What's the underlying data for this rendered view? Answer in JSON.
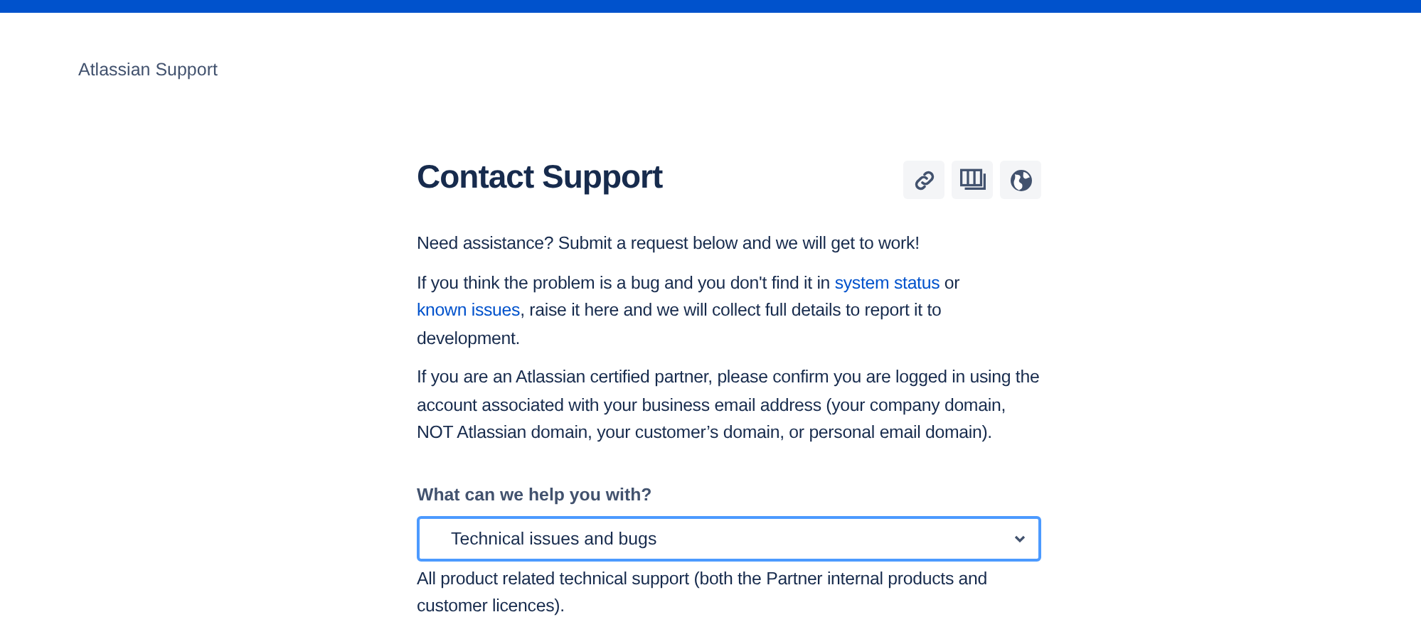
{
  "header": {
    "site_title": "Atlassian Support"
  },
  "page": {
    "title": "Contact Support",
    "actions": [
      {
        "kind": "link"
      },
      {
        "kind": "board"
      },
      {
        "kind": "globe"
      }
    ],
    "paragraphs": [
      [
        {
          "kind": "text",
          "text": "Need assistance? Submit a request below and we will get to work!"
        }
      ],
      [
        {
          "kind": "text",
          "text": "If you think the problem is a bug and you don't find it in "
        },
        {
          "kind": "link",
          "text": "system status"
        },
        {
          "kind": "text",
          "text": " or "
        },
        {
          "kind": "link",
          "text": "known issues"
        },
        {
          "kind": "text",
          "text": ", raise it here and we will collect full details to report it to development."
        }
      ],
      [
        {
          "kind": "text",
          "text": "If you are an Atlassian certified partner, please confirm you are logged in using the account associated with your business email address (your company domain, NOT Atlassian domain, your customer’s domain, or personal email domain)."
        }
      ]
    ]
  },
  "form": {
    "label": "What can we help you with?",
    "value": "Technical issues and bugs",
    "focused": true,
    "help": "All product related technical support (both the Partner internal products and customer licences)."
  }
}
